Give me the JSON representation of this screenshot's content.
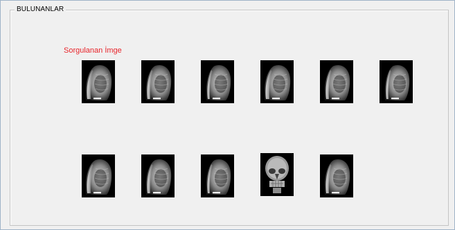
{
  "group": {
    "title": "BULUNANLAR"
  },
  "query": {
    "label": "Sorgulanan İmge",
    "label_color": "#e8242a"
  },
  "results": [
    {
      "kind": "lateral-chest-xray",
      "row": 1,
      "col": 1
    },
    {
      "kind": "lateral-chest-xray",
      "row": 1,
      "col": 2
    },
    {
      "kind": "lateral-chest-xray",
      "row": 1,
      "col": 3
    },
    {
      "kind": "lateral-chest-xray",
      "row": 1,
      "col": 4
    },
    {
      "kind": "lateral-chest-xray",
      "row": 1,
      "col": 5
    },
    {
      "kind": "lateral-chest-xray",
      "row": 1,
      "col": 6
    },
    {
      "kind": "lateral-chest-xray",
      "row": 2,
      "col": 1
    },
    {
      "kind": "lateral-chest-xray",
      "row": 2,
      "col": 2
    },
    {
      "kind": "lateral-chest-xray",
      "row": 2,
      "col": 3
    },
    {
      "kind": "frontal-skull-xray",
      "row": 2,
      "col": 4
    },
    {
      "kind": "lateral-chest-xray",
      "row": 2,
      "col": 5
    }
  ]
}
